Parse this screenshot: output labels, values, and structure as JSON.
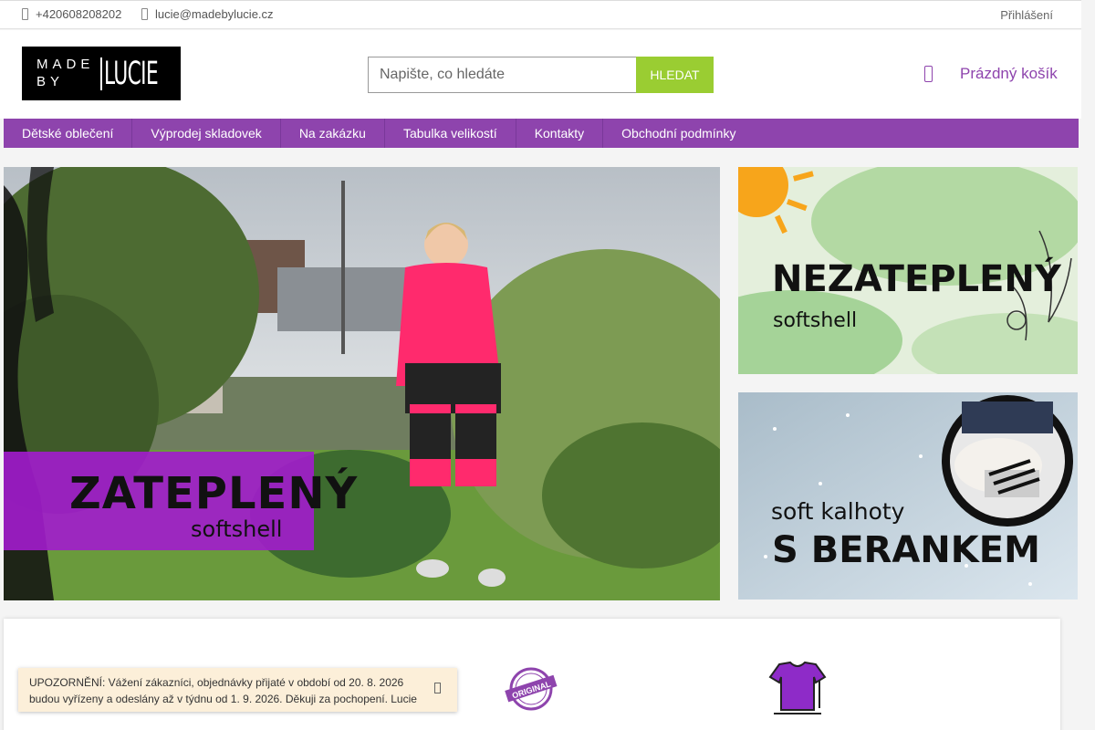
{
  "topbar": {
    "phone": "+420608208202",
    "email": "lucie@madebylucie.cz",
    "login": "Přihlášení"
  },
  "logo": {
    "line1": "MADE",
    "line2": "BY",
    "name": "LUCIE"
  },
  "search": {
    "placeholder": "Napište, co hledáte",
    "button": "HLEDAT"
  },
  "cart": {
    "label": "Prázdný košík"
  },
  "nav": {
    "items": [
      {
        "label": "Dětské oblečení"
      },
      {
        "label": "Výprodej skladovek"
      },
      {
        "label": "Na zakázku"
      },
      {
        "label": "Tabulka velikostí"
      },
      {
        "label": "Kontakty"
      },
      {
        "label": "Obchodní podmínky"
      }
    ]
  },
  "banners": {
    "main": {
      "line1": "ZATEPLENÝ",
      "line2": "softshell"
    },
    "side1": {
      "line1": "NEZATEPLENÝ",
      "line2": "softshell"
    },
    "side2": {
      "line1": "soft kalhoty",
      "line2": "S BERANKEM"
    }
  },
  "badges": {
    "original": "ORIGINAL"
  },
  "notice": {
    "text": "UPOZORNĚNÍ: Vážení zákazníci, objednávky přijaté v období od 20. 8. 2026 budou vyřízeny a odeslány až v týdnu od 1. 9. 2026. Děkuji za pochopení. Lucie"
  },
  "colors": {
    "brand_purple": "#8e44ad",
    "search_green": "#9acd32",
    "notice_bg": "#fcefd9"
  }
}
